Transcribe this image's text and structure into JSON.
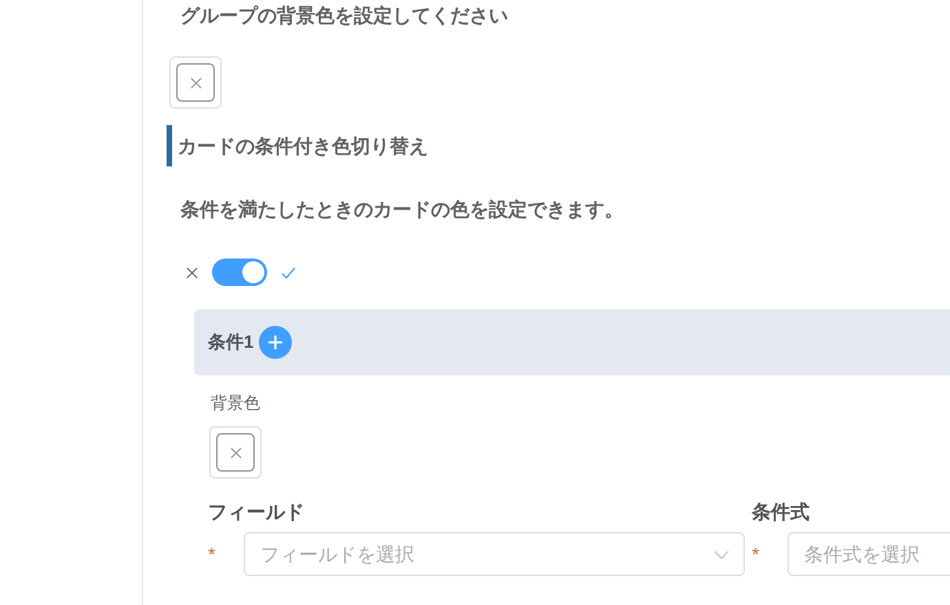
{
  "group_color": {
    "label": "グループの背景色を設定してください"
  },
  "section": {
    "title": "カードの条件付き色切り替え",
    "description": "条件を満たしたときのカードの色を設定できます。",
    "toggle": {
      "on": true
    }
  },
  "condition": {
    "title": "条件1",
    "color_label": "背景色",
    "fields": [
      {
        "label": "フィールド",
        "required_mark": "*",
        "placeholder": "フィールドを選択",
        "dropdown": true
      },
      {
        "label": "条件式",
        "required_mark": "*",
        "placeholder": "条件式を選択"
      }
    ]
  }
}
